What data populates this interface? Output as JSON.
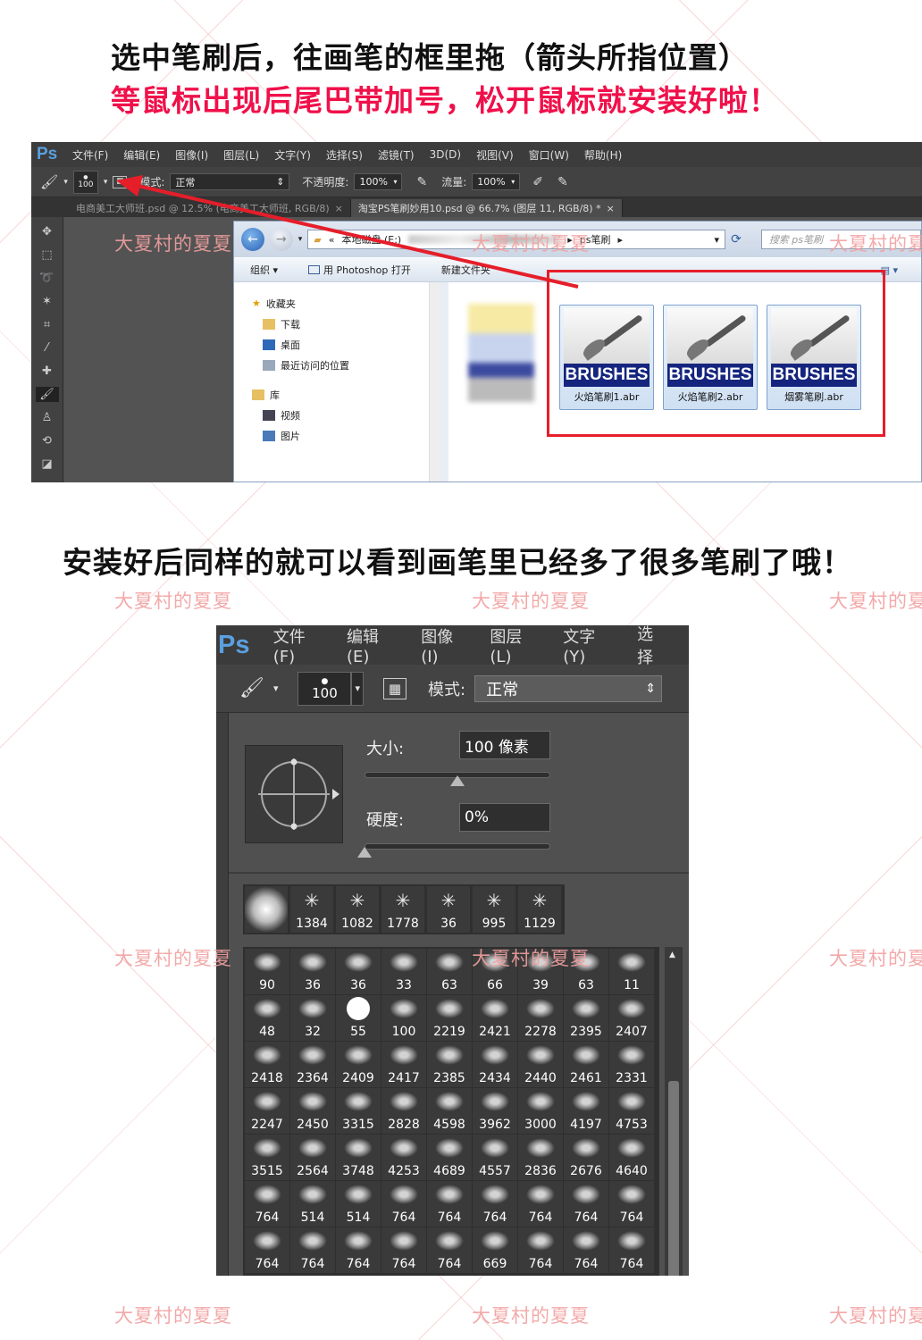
{
  "headings": {
    "line1": "选中笔刷后，往画笔的框里拖（箭头所指位置）",
    "line2": "等鼠标出现后尾巴带加号，松开鼠标就安装好啦！",
    "line3": "安装好后同样的就可以看到画笔里已经多了很多笔刷了哦！"
  },
  "watermark": "大夏村的夏夏",
  "colors": {
    "heading": "#111111",
    "highlight": "#f0104a",
    "watermark": "#f2a0a0",
    "red_box": "#e51e2a"
  },
  "ps1": {
    "logo": "Ps",
    "menus": [
      "文件(F)",
      "编辑(E)",
      "图像(I)",
      "图层(L)",
      "文字(Y)",
      "选择(S)",
      "滤镜(T)",
      "3D(D)",
      "视图(V)",
      "窗口(W)",
      "帮助(H)"
    ],
    "options": {
      "brush_size": "100",
      "mode_label": "模式:",
      "mode_value": "正常",
      "opacity_label": "不透明度:",
      "opacity_value": "100%",
      "flow_label": "流量:",
      "flow_value": "100%"
    },
    "tabs": [
      {
        "label": "电商美工大师班.psd @ 12.5% (电商美工大师班, RGB/8)",
        "close": "×"
      },
      {
        "label": "淘宝PS笔刷妙用10.psd @ 66.7% (图层 11, RGB/8) *",
        "close": "×"
      }
    ],
    "explorer": {
      "drive": "本地磁盘 (E:)",
      "folder": "ps笔刷",
      "search_placeholder": "搜索 ps笔刷",
      "commands": [
        "组织 ▾",
        "用 Photoshop 打开",
        "新建文件夹"
      ],
      "sidebar": [
        "收藏夹",
        "下载",
        "桌面",
        "最近访问的位置",
        "库",
        "视频",
        "图片"
      ],
      "files": [
        {
          "badge": "BRUSHES",
          "name": "火焰笔刷1.abr"
        },
        {
          "badge": "BRUSHES",
          "name": "火焰笔刷2.abr"
        },
        {
          "badge": "BRUSHES",
          "name": "烟雾笔刷.abr"
        }
      ]
    }
  },
  "ps2": {
    "logo": "Ps",
    "menus": [
      "文件(F)",
      "编辑(E)",
      "图像(I)",
      "图层(L)",
      "文字(Y)",
      "选择"
    ],
    "brush_size": "100",
    "mode_label": "模式:",
    "mode_value": "正常",
    "size_label": "大小:",
    "size_value": "100 像素",
    "size_fraction": 0.5,
    "hardness_label": "硬度:",
    "hardness_value": "0%",
    "hardness_fraction": 0,
    "presets": [
      "",
      "1384",
      "1082",
      "1778",
      "36",
      "995",
      "1129"
    ],
    "brushes": [
      "90",
      "36",
      "36",
      "33",
      "63",
      "66",
      "39",
      "63",
      "11",
      "48",
      "32",
      "55",
      "100",
      "2219",
      "2421",
      "2278",
      "2395",
      "2407",
      "2418",
      "2364",
      "2409",
      "2417",
      "2385",
      "2434",
      "2440",
      "2461",
      "2331",
      "2247",
      "2450",
      "3315",
      "2828",
      "4598",
      "3962",
      "3000",
      "4197",
      "4753",
      "3515",
      "2564",
      "3748",
      "4253",
      "4689",
      "4557",
      "2836",
      "2676",
      "4640",
      "764",
      "514",
      "514",
      "764",
      "764",
      "764",
      "764",
      "764",
      "764",
      "764",
      "764",
      "764",
      "764",
      "764",
      "669",
      "764",
      "764",
      "764"
    ]
  }
}
